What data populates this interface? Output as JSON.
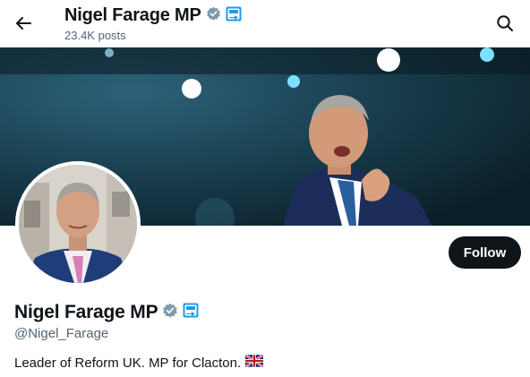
{
  "header": {
    "name": "Nigel Farage MP",
    "posts_count": "23.4K posts"
  },
  "profile": {
    "name": "Nigel Farage MP",
    "handle": "@Nigel_Farage",
    "bio": "Leader of Reform UK. MP for Clacton.",
    "follow_label": "Follow"
  },
  "icons": {
    "back": "arrow-left-icon",
    "search": "search-icon",
    "verified": "verified-badge-icon",
    "affiliate": "affiliate-badge-icon",
    "flag": "uk-flag-icon"
  },
  "colors": {
    "primary_text": "#0f1419",
    "secondary_text": "#536471",
    "verified_badge": "#829aab",
    "affiliate_badge": "#1d9bf0",
    "follow_button": "#0f1419"
  }
}
